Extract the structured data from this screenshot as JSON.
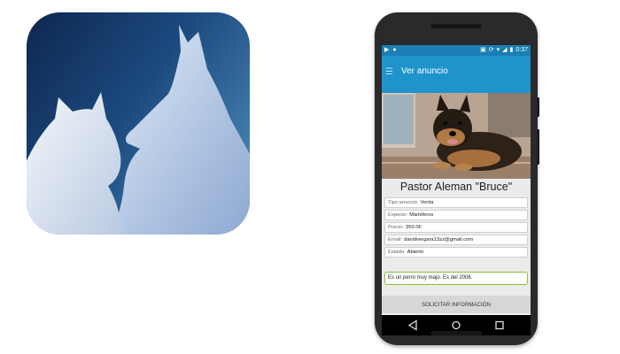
{
  "phone": {
    "status_bar": {
      "time": "0:37"
    },
    "action_bar": {
      "title": "Ver anuncio"
    },
    "pet": {
      "name": "Pastor Aleman \"Bruce\"",
      "fields": [
        {
          "label": "Tipo anuncio:",
          "value": "Venta"
        },
        {
          "label": "Especie:",
          "value": "Mamiferos"
        },
        {
          "label": "Precio:",
          "value": "350.0€"
        },
        {
          "label": "Email:",
          "value": "davidvergara13zz@gmail.com"
        },
        {
          "label": "Estado:",
          "value": "Abierto"
        }
      ],
      "description": "Es un perro muy majo. Es del 2006."
    },
    "request_button_label": "SOLICITAR INFORMACIÓN"
  },
  "icons": {
    "app_icon": "cat-dog-silhouette-icon",
    "menu": "menu-icon",
    "nav_back": "back-icon",
    "nav_home": "home-icon",
    "nav_recents": "recents-icon"
  },
  "colors": {
    "status_bar": "#1a7fb4",
    "action_bar": "#1f93cc",
    "description_border": "#8cbf3a",
    "icon_bg_dark": "#0e2750",
    "icon_bg_light": "#5c93bd"
  }
}
